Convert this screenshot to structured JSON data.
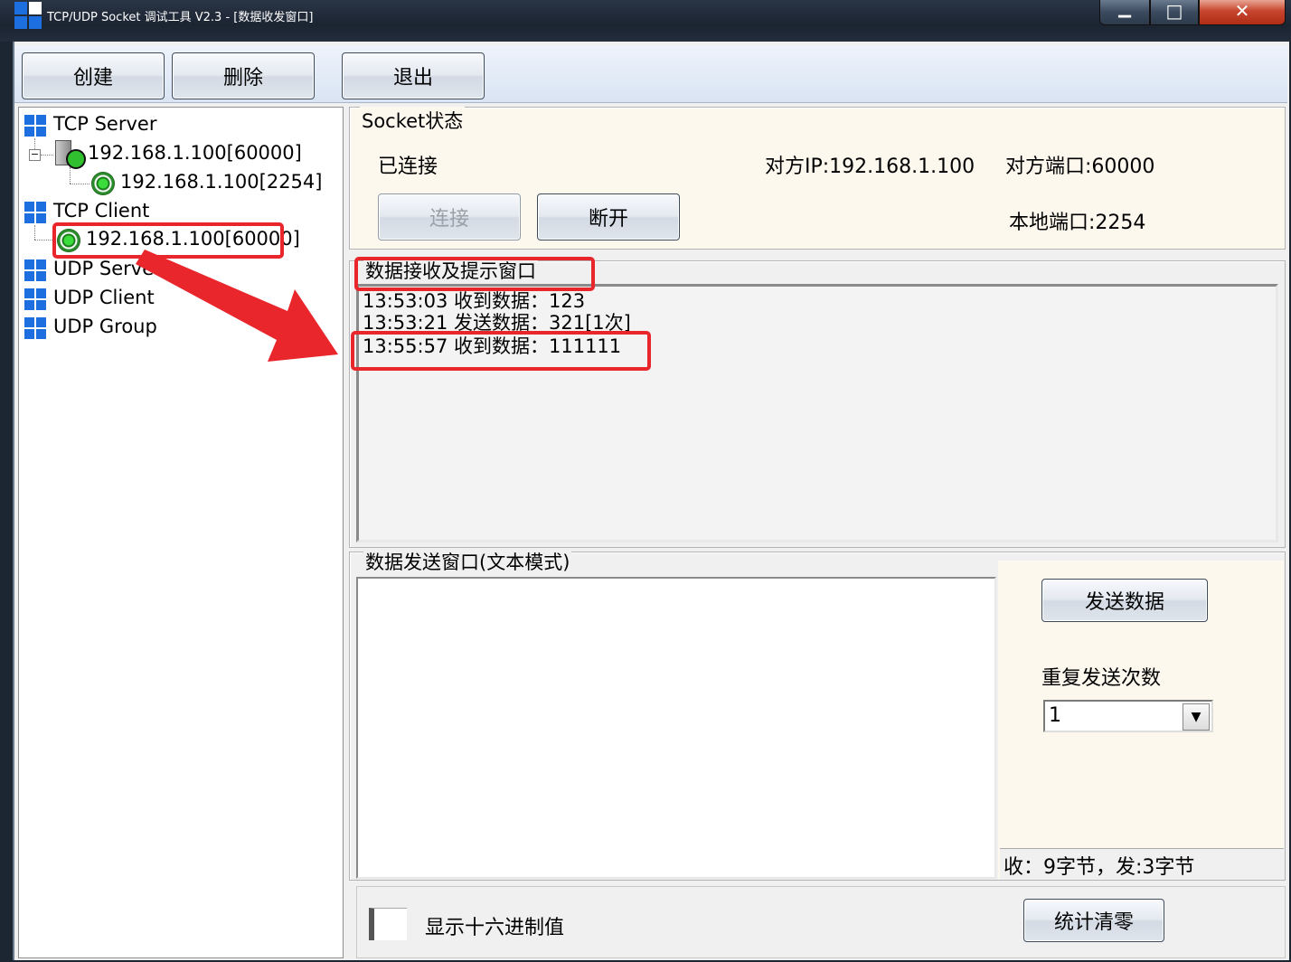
{
  "window": {
    "title": "TCP/UDP Socket 调试工具 V2.3 - [数据收发窗口]",
    "min_glyph": "▁",
    "max_glyph": "□",
    "close_glyph": "✕"
  },
  "toolbar": {
    "create_label": "创建",
    "delete_label": "删除",
    "exit_label": "退出"
  },
  "tree": {
    "tcp_server": "TCP Server",
    "tcp_server_listener": "192.168.1.100[60000]",
    "tcp_server_connection": "192.168.1.100[2254]",
    "tcp_client": "TCP Client",
    "tcp_client_connection": "192.168.1.100[60000]",
    "udp_server": "UDP Server",
    "udp_client": "UDP Client",
    "udp_group": "UDP Group",
    "expander_glyph": "−"
  },
  "socket_status": {
    "legend": "Socket状态",
    "state": "已连接",
    "remote_ip": "对方IP:192.168.1.100",
    "remote_port": "对方端口:60000",
    "local_port": "本地端口:2254",
    "connect_label": "连接",
    "disconnect_label": "断开"
  },
  "receive": {
    "legend": "数据接收及提示窗口",
    "log": [
      "13:53:03 收到数据：123",
      "13:53:21 发送数据：321[1次]",
      "13:55:57 收到数据：111111"
    ]
  },
  "send": {
    "legend": "数据发送窗口(文本模式)",
    "send_label": "发送数据",
    "repeat_label": "重复发送次数",
    "repeat_value": "1",
    "stats": "收：9字节，发:3字节",
    "hex_label": "显示十六进制值",
    "clear_label": "统计清零",
    "combo_arrow": "▼"
  },
  "colors": {
    "accent_blue": "#1d6fe0",
    "highlight_red": "#e8262c",
    "panel_cream": "#fdf8ee"
  }
}
